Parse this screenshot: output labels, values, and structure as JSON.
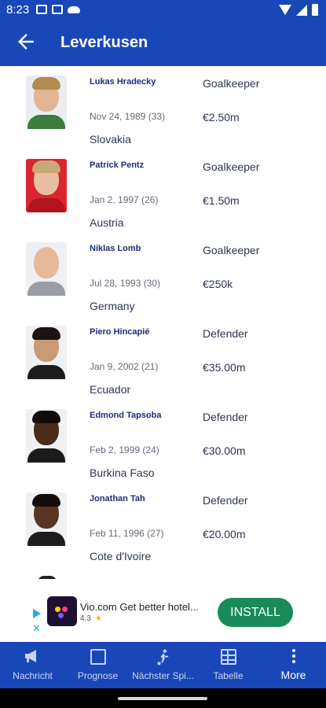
{
  "status_bar": {
    "time": "8:23",
    "left_icons": [
      "calendar-icon",
      "calendar-icon",
      "cloud-icon"
    ],
    "right_icons": [
      "wifi-icon",
      "signal-icon",
      "battery-icon"
    ]
  },
  "app_bar": {
    "title": "Leverkusen",
    "back_icon": "arrow-left-icon"
  },
  "players": [
    {
      "name": "Lukas Hradecky",
      "position": "Goalkeeper",
      "birth": "Nov 24, 1989 (33)",
      "value": "€2.50m",
      "nationality": "Slovakia"
    },
    {
      "name": "Patrick Pentz",
      "position": "Goalkeeper",
      "birth": "Jan 2, 1997 (26)",
      "value": "€1.50m",
      "nationality": "Austria"
    },
    {
      "name": "Niklas Lomb",
      "position": "Goalkeeper",
      "birth": "Jul 28, 1993 (30)",
      "value": "€250k",
      "nationality": "Germany"
    },
    {
      "name": "Piero Hincapié",
      "position": "Defender",
      "birth": "Jan 9, 2002 (21)",
      "value": "€35.00m",
      "nationality": "Ecuador"
    },
    {
      "name": "Edmond Tapsoba",
      "position": "Defender",
      "birth": "Feb 2, 1999 (24)",
      "value": "€30.00m",
      "nationality": "Burkina Faso"
    },
    {
      "name": "Jonathan Tah",
      "position": "Defender",
      "birth": "Feb 11, 1996 (27)",
      "value": "€20.00m",
      "nationality": "Cote d'Ivoire"
    }
  ],
  "ad": {
    "title": "Vio.com Get better hotel...",
    "rating": "4.3",
    "install_label": "INSTALL",
    "colors": {
      "button": "#198a5a",
      "icon_bg": "#1e1130"
    }
  },
  "bottom_nav": {
    "items": [
      {
        "label": "Nachricht",
        "icon": "megaphone-icon"
      },
      {
        "label": "Prognose",
        "icon": "prognose-icon"
      },
      {
        "label": "Nächster Spi...",
        "icon": "soccer-player-icon"
      },
      {
        "label": "Tabelle",
        "icon": "table-icon"
      },
      {
        "label": "More",
        "icon": "more-icon",
        "active": true
      }
    ]
  },
  "colors": {
    "primary": "#1a47b8",
    "name_text": "#1f2c7a",
    "body_text": "#2c3550"
  }
}
